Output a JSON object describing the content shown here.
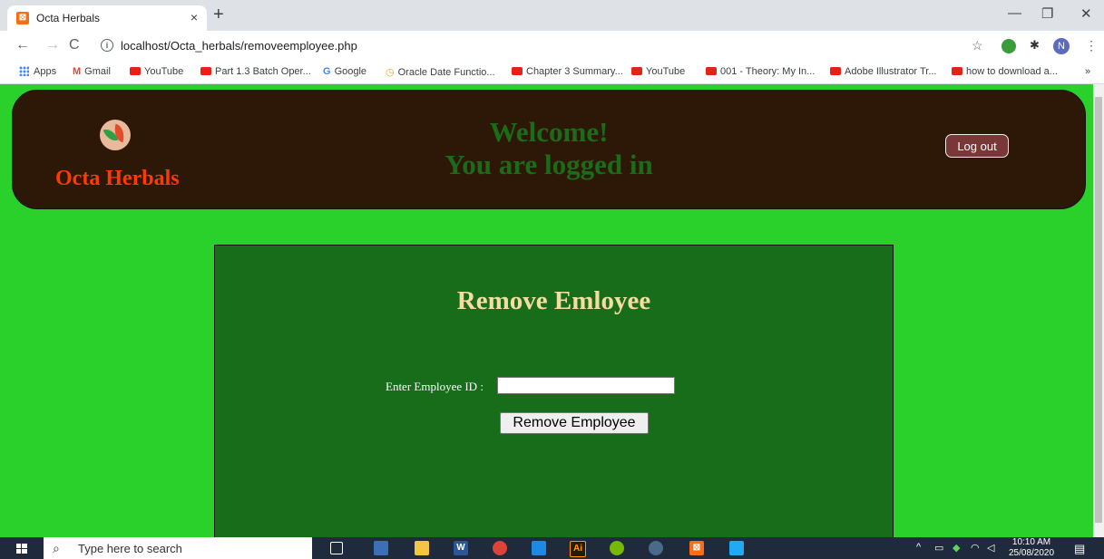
{
  "browser": {
    "tab_title": "Octa Herbals",
    "tab_close": "×",
    "new_tab": "+",
    "url": "localhost/Octa_herbals/removeemployee.php",
    "profile_initial": "N",
    "window_controls": {
      "minimize": "—",
      "restore": "❐",
      "close": "✕"
    }
  },
  "bookmarks": [
    {
      "label": "Apps",
      "icon": "apps-icon"
    },
    {
      "label": "Gmail",
      "icon": "gmail-icon"
    },
    {
      "label": "YouTube",
      "icon": "youtube-icon"
    },
    {
      "label": "Part 1.3 Batch Oper...",
      "icon": "youtube-icon"
    },
    {
      "label": "Google",
      "icon": "google-icon"
    },
    {
      "label": "Oracle Date Functio...",
      "icon": "oracle-icon"
    },
    {
      "label": "Chapter 3 Summary...",
      "icon": "youtube-icon"
    },
    {
      "label": "YouTube",
      "icon": "youtube-icon"
    },
    {
      "label": "001 - Theory: My In...",
      "icon": "youtube-icon"
    },
    {
      "label": "Adobe Illustrator Tr...",
      "icon": "youtube-icon"
    },
    {
      "label": "how to download a...",
      "icon": "youtube-icon"
    }
  ],
  "header": {
    "brand": "Octa Herbals",
    "welcome_line1": "Welcome!",
    "welcome_line2": "You are logged in",
    "logout_label": "Log out"
  },
  "form": {
    "title": "Remove Emloyee",
    "id_label": "Enter Employee ID :",
    "id_value": "",
    "submit_label": "Remove Employee"
  },
  "taskbar": {
    "search_placeholder": "Type here to search",
    "time": "10:10 AM",
    "date": "25/08/2020"
  },
  "colors": {
    "page_bg": "#2ad12a",
    "header_bg": "#2d1808",
    "panel_bg": "#186d1a",
    "brand_text": "#ff3a00",
    "welcome_text": "#1c6b18",
    "title_text": "#f6dca1",
    "logout_bg": "#7a3737"
  }
}
